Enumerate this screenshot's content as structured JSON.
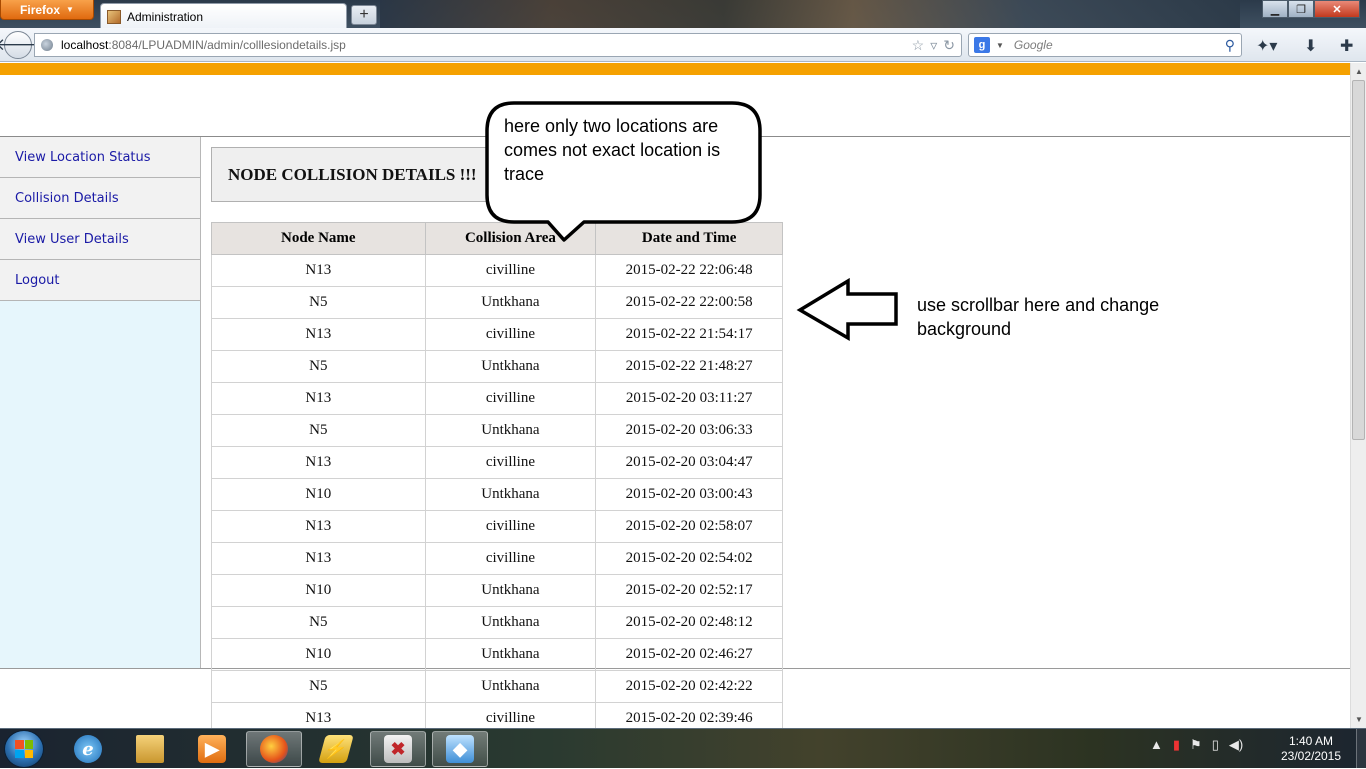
{
  "browser": {
    "menu_button": "Firefox",
    "tab_title": "Administration",
    "new_tab": "+",
    "url_host": "localhost",
    "url_path": ":8084/LPUADMIN/admin/colllesiondetails.jsp",
    "search_placeholder": "Google",
    "search_engine_letter": "g"
  },
  "sidebar": {
    "items": [
      {
        "label": "View Location Status"
      },
      {
        "label": "Collision Details"
      },
      {
        "label": "View User Details"
      },
      {
        "label": "Logout"
      }
    ]
  },
  "main": {
    "title": "NODE COLLISION DETAILS !!!",
    "columns": [
      "Node Name",
      "Collision Area",
      "Date and Time"
    ],
    "rows": [
      [
        "N13",
        "civilline",
        "2015-02-22 22:06:48"
      ],
      [
        "N5",
        "Untkhana",
        "2015-02-22 22:00:58"
      ],
      [
        "N13",
        "civilline",
        "2015-02-22 21:54:17"
      ],
      [
        "N5",
        "Untkhana",
        "2015-02-22 21:48:27"
      ],
      [
        "N13",
        "civilline",
        "2015-02-20 03:11:27"
      ],
      [
        "N5",
        "Untkhana",
        "2015-02-20 03:06:33"
      ],
      [
        "N13",
        "civilline",
        "2015-02-20 03:04:47"
      ],
      [
        "N10",
        "Untkhana",
        "2015-02-20 03:00:43"
      ],
      [
        "N13",
        "civilline",
        "2015-02-20 02:58:07"
      ],
      [
        "N13",
        "civilline",
        "2015-02-20 02:54:02"
      ],
      [
        "N10",
        "Untkhana",
        "2015-02-20 02:52:17"
      ],
      [
        "N5",
        "Untkhana",
        "2015-02-20 02:48:12"
      ],
      [
        "N10",
        "Untkhana",
        "2015-02-20 02:46:27"
      ],
      [
        "N5",
        "Untkhana",
        "2015-02-20 02:42:22"
      ],
      [
        "N13",
        "civilline",
        "2015-02-20 02:39:46"
      ]
    ]
  },
  "annotations": {
    "bubble_text": "here only two locations are comes not exact location is trace",
    "arrow_text": "use scrollbar here and change background"
  },
  "taskbar": {
    "clock_time": "1:40 AM",
    "clock_date": "23/02/2015"
  }
}
